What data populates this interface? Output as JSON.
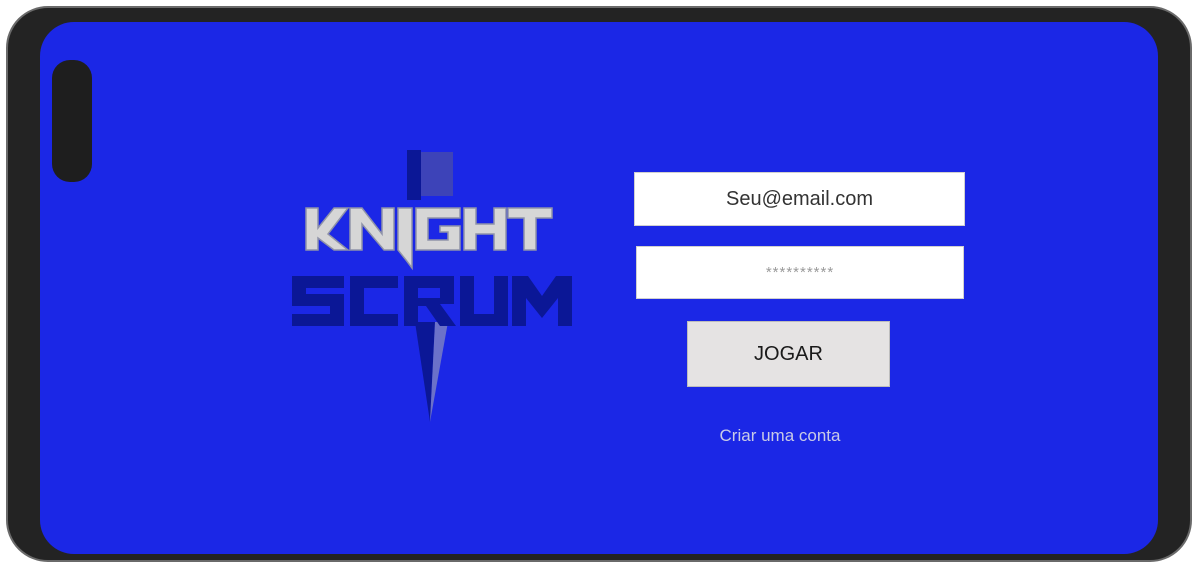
{
  "app": {
    "logo_text": [
      "KNIGHT",
      "SCRUM"
    ]
  },
  "login": {
    "email_placeholder": "Seu@email.com",
    "password_placeholder": "**********",
    "play_label": "JOGAR",
    "create_account_label": "Criar uma conta"
  },
  "colors": {
    "screen_background": "#1b27e6",
    "device_frame": "#232323",
    "button_background": "#e5e3e3",
    "logo_dark_blue": "#0b1796",
    "logo_light_gray": "#d6d6d6"
  }
}
